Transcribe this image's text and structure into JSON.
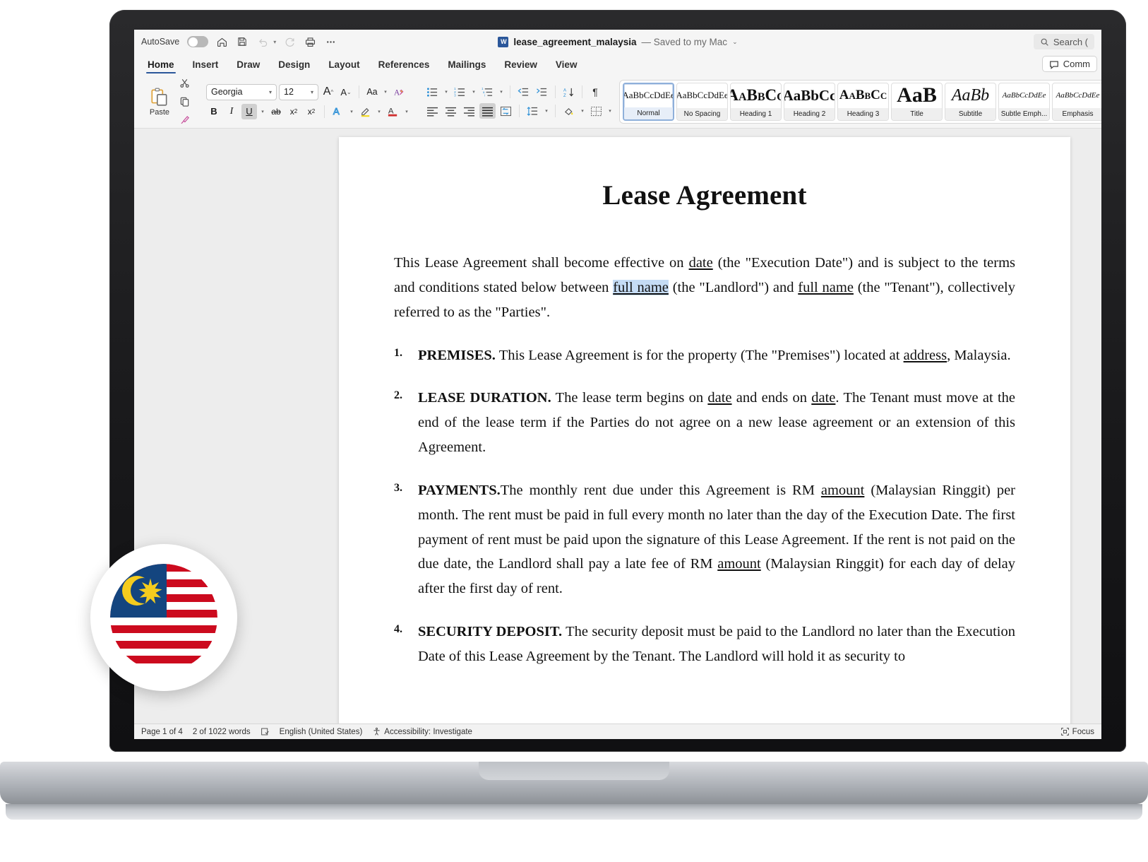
{
  "titlebar": {
    "autosave_label": "AutoSave",
    "autosave_state": "off",
    "doc_name": "lease_agreement_malaysia",
    "doc_state": "— Saved to my Mac",
    "word_mark": "W",
    "search_placeholder": "Search (",
    "comments_label": "Comm",
    "icons": [
      "home-icon",
      "save-icon",
      "undo-icon",
      "redo-icon",
      "print-icon",
      "more-icon"
    ]
  },
  "tabs": [
    {
      "label": "Home",
      "active": true
    },
    {
      "label": "Insert",
      "active": false
    },
    {
      "label": "Draw",
      "active": false
    },
    {
      "label": "Design",
      "active": false
    },
    {
      "label": "Layout",
      "active": false
    },
    {
      "label": "References",
      "active": false
    },
    {
      "label": "Mailings",
      "active": false
    },
    {
      "label": "Review",
      "active": false
    },
    {
      "label": "View",
      "active": false
    }
  ],
  "ribbon": {
    "paste_label": "Paste",
    "font_name": "Georgia",
    "font_size": "12",
    "grow_font": "A",
    "shrink_font": "A",
    "change_case": "Aa",
    "clear_format": "A",
    "bold": "B",
    "italic": "I",
    "underline": "U",
    "strikethrough": "ab",
    "subscript": "x",
    "superscript": "x",
    "active_toggles": [
      "underline",
      "justify"
    ]
  },
  "styles": [
    {
      "preview": "AaBbCcDdEe",
      "name": "Normal",
      "selected": true,
      "size": 13,
      "weight": "normal",
      "style": "normal"
    },
    {
      "preview": "AaBbCcDdEe",
      "name": "No Spacing",
      "selected": false,
      "size": 13,
      "weight": "normal",
      "style": "normal"
    },
    {
      "preview": "AaBbCc",
      "name": "Heading 1",
      "selected": false,
      "size": 23,
      "weight": "bold",
      "style": "normal"
    },
    {
      "preview": "AaBbCc",
      "name": "Heading 2",
      "selected": false,
      "size": 21,
      "weight": "bold",
      "style": "normal"
    },
    {
      "preview": "AaBbCc",
      "name": "Heading 3",
      "selected": false,
      "size": 19,
      "weight": "bold",
      "style": "normal"
    },
    {
      "preview": "AaB",
      "name": "Title",
      "selected": false,
      "size": 30,
      "weight": "bold",
      "style": "normal"
    },
    {
      "preview": "AaBb",
      "name": "Subtitle",
      "selected": false,
      "size": 24,
      "weight": "normal",
      "style": "italic"
    },
    {
      "preview": "AaBbCcDdEe",
      "name": "Subtle Emph...",
      "selected": false,
      "size": 11,
      "weight": "normal",
      "style": "italic"
    },
    {
      "preview": "AaBbCcDdEe",
      "name": "Emphasis",
      "selected": false,
      "size": 11,
      "weight": "normal",
      "style": "italic"
    }
  ],
  "document": {
    "title": "Lease Agreement",
    "intro": {
      "a": "This Lease Agreement shall become effective on ",
      "blank1": "date",
      "b": " (the \"Execution Date\") and is subject to the terms and conditions stated below between ",
      "blank2": "full name",
      "c": " (the \"Landlord\") and ",
      "blank3": "full name",
      "d": " (the \"Tenant\"), collectively referred to as the \"Parties\"."
    },
    "clauses": [
      {
        "num": "1.",
        "heading": "PREMISES.",
        "a": " This Lease Agreement is for the property (The \"Premises\") located at ",
        "blank1": "address",
        "b": ", Malaysia.",
        "blank2": "",
        "c": ""
      },
      {
        "num": "2.",
        "heading": "LEASE DURATION.",
        "a": " The lease term begins on ",
        "blank1": "date",
        "b": " and ends on ",
        "blank2": "date",
        "c": ". The Tenant must move at the end of the lease term if the Parties do not agree on a new lease agreement or an extension of this Agreement."
      },
      {
        "num": "3.",
        "heading": "PAYMENTS.",
        "a": "The monthly rent due under this Agreement is RM ",
        "blank1": "amount",
        "b": " (Malaysian Ringgit) per month. The rent must be paid in full every month no later than the day of the Execution Date. The first payment of rent must be paid upon the signature of this Lease Agreement. If the rent is not paid on the due date, the Landlord shall pay a late fee of RM ",
        "blank2": "amount",
        "c": " (Malaysian Ringgit) for each day of delay after the first day of rent."
      },
      {
        "num": "4.",
        "heading": "SECURITY DEPOSIT.",
        "a": " The security deposit must be paid to the Landlord no later than the Execution Date of this Lease Agreement by the Tenant. The Landlord will hold it as security to",
        "blank1": "",
        "b": "",
        "blank2": "",
        "c": ""
      }
    ]
  },
  "statusbar": {
    "page": "Page 1 of 4",
    "words": "2 of 1022 words",
    "language": "English (United States)",
    "accessibility": "Accessibility: Investigate",
    "focus": "Focus"
  },
  "flag": {
    "country": "Malaysia",
    "blue": "#14457f",
    "red": "#cc0a1e",
    "white": "#ffffff",
    "yellow": "#f5cc1e"
  }
}
